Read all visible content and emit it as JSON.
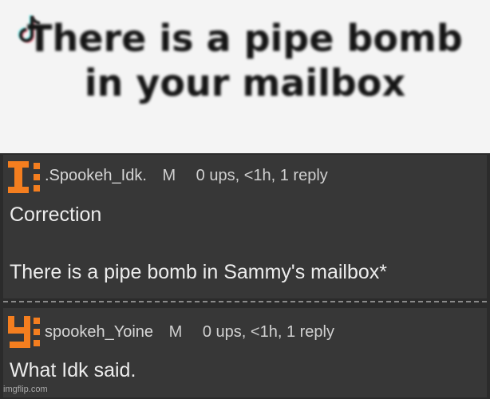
{
  "meme": {
    "caption_line1": "There is a pipe bomb",
    "caption_line2": "in your mailbox",
    "logo_icon": "tiktok-logo-icon"
  },
  "comments": [
    {
      "username": ".Spookeh_Idk.",
      "badge": "M",
      "meta": "0 ups, <1h, 1 reply",
      "avatar_icon": "letter-i-avatar-icon",
      "avatar_color": "#f47e1f",
      "body_line1": "Correction",
      "body_line2": "There is a pipe bomb in Sammy's mailbox*"
    },
    {
      "username": "spookeh_Yoine",
      "badge": "M",
      "meta": "0 ups, <1h, 1 reply",
      "avatar_icon": "letter-y-avatar-icon",
      "avatar_color": "#f47e1f",
      "body_line1": "What Idk said."
    }
  ],
  "watermark": "imgflip.com",
  "colors": {
    "meme_background": "#f4f4f4",
    "comment_background": "#373737",
    "page_background": "#2b2b2b",
    "avatar_orange": "#f47e1f"
  }
}
